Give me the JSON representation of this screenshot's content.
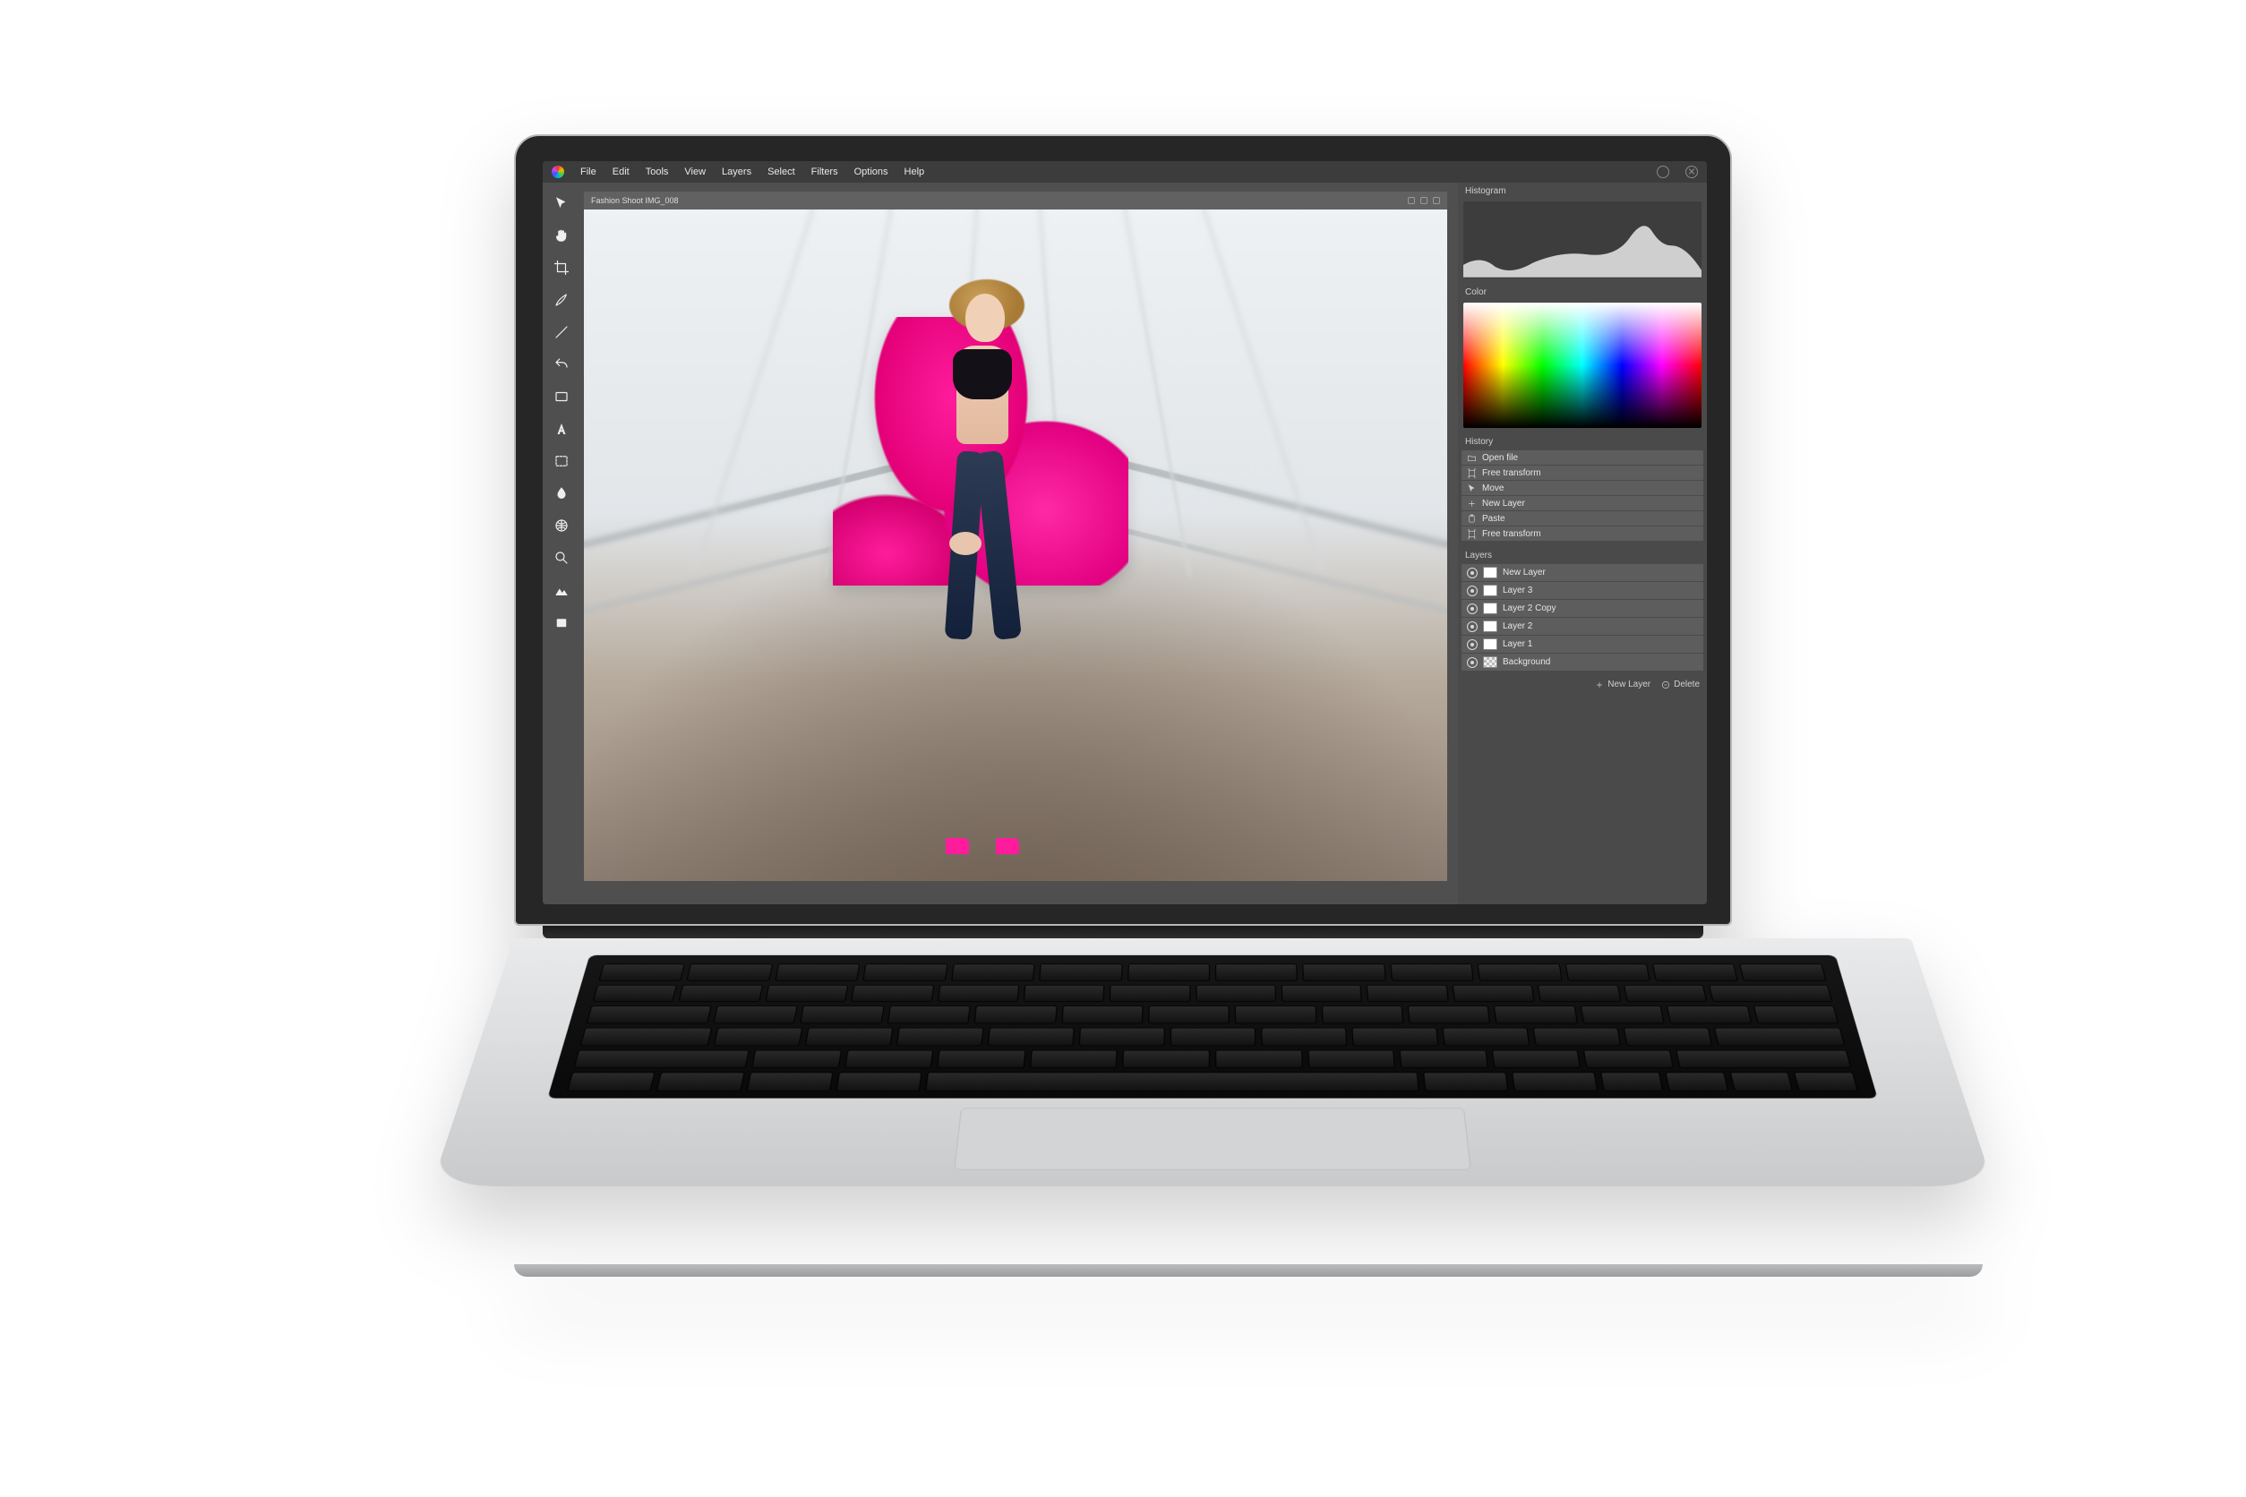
{
  "menubar": {
    "items": [
      "File",
      "Edit",
      "Tools",
      "View",
      "Layers",
      "Select",
      "Filters",
      "Options",
      "Help"
    ]
  },
  "document": {
    "title": "Fashion Shoot IMG_008"
  },
  "tools": [
    {
      "name": "pointer-icon",
      "label": "Pointer"
    },
    {
      "name": "hand-icon",
      "label": "Hand"
    },
    {
      "name": "crop-icon",
      "label": "Crop"
    },
    {
      "name": "brush-icon",
      "label": "Brush"
    },
    {
      "name": "line-icon",
      "label": "Line"
    },
    {
      "name": "undo-icon",
      "label": "Undo"
    },
    {
      "name": "rect-icon",
      "label": "Rectangle"
    },
    {
      "name": "text-icon",
      "label": "Text"
    },
    {
      "name": "marquee-icon",
      "label": "Marquee Rect"
    },
    {
      "name": "drop-icon",
      "label": "Fill"
    },
    {
      "name": "grid-icon",
      "label": "Grid"
    },
    {
      "name": "zoom-icon",
      "label": "Zoom"
    },
    {
      "name": "mountains-icon",
      "label": "Image"
    },
    {
      "name": "layer-icon",
      "label": "Layer Fill"
    }
  ],
  "panels": {
    "histogram": {
      "title": "Histogram"
    },
    "color": {
      "title": "Color"
    },
    "history": {
      "title": "History",
      "items": [
        {
          "icon": "folder-icon",
          "label": "Open file"
        },
        {
          "icon": "transform-icon",
          "label": "Free transform"
        },
        {
          "icon": "pointer-icon",
          "label": "Move"
        },
        {
          "icon": "plus-icon",
          "label": "New Layer"
        },
        {
          "icon": "paste-icon",
          "label": "Paste"
        },
        {
          "icon": "transform-icon",
          "label": "Free transform"
        }
      ]
    },
    "layers": {
      "title": "Layers",
      "items": [
        {
          "thumb": "white",
          "label": "New Layer"
        },
        {
          "thumb": "white",
          "label": "Layer 3"
        },
        {
          "thumb": "white",
          "label": "Layer 2 Copy"
        },
        {
          "thumb": "white",
          "label": "Layer 2"
        },
        {
          "thumb": "white",
          "label": "Layer 1"
        },
        {
          "thumb": "chk",
          "label": "Background"
        }
      ],
      "footer": {
        "new": "New Layer",
        "delete": "Delete"
      }
    }
  }
}
